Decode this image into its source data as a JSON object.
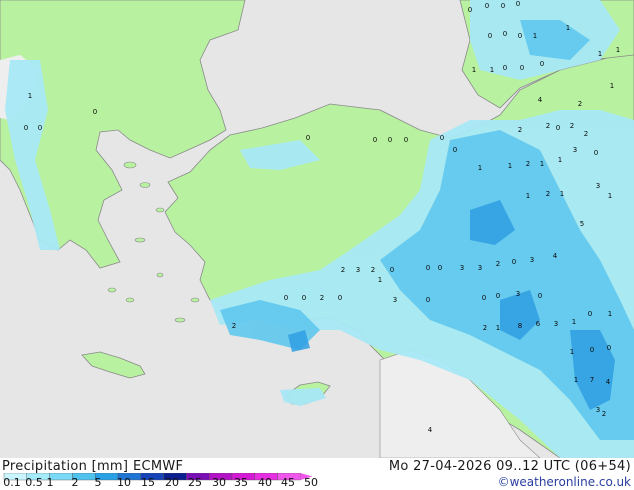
{
  "footer": {
    "product_label": "Precipitation [mm]",
    "model": "ECMWF",
    "valid_time": "Mo 27-04-2026 09..12 UTC (06+54)",
    "credit": "©weatheronline.co.uk"
  },
  "legend": {
    "ticks": [
      "0.1",
      "0.5",
      "1",
      "2",
      "5",
      "10",
      "15",
      "20",
      "25",
      "30",
      "35",
      "40",
      "45",
      "50"
    ],
    "colors": [
      "#c8f5ff",
      "#a6ebfa",
      "#7ad9f4",
      "#4fc3ee",
      "#2aa1e6",
      "#1f74d4",
      "#1644b8",
      "#0b1f8f",
      "#7a0fb5",
      "#b313c7",
      "#d41ad4",
      "#e62fe0",
      "#f055ec"
    ]
  },
  "map_colors": {
    "sea": "#e6e6e6",
    "land_dry": "#eeeeee",
    "land_wet": "#b8f2a0",
    "coast": "#8a8a8a",
    "light_rain": "#a8e8f6",
    "moderate_rain": "#5fc8ee",
    "heavy_rain": "#2f9fe2"
  },
  "precip_labels": [
    "0",
    "0",
    "0",
    "0",
    "0",
    "0",
    "0",
    "1",
    "1",
    "1",
    "1",
    "0",
    "0",
    "0",
    "1",
    "1",
    "1",
    "4",
    "2",
    "0",
    "2",
    "2",
    "2",
    "1",
    "0",
    "0",
    "0",
    "0",
    "0",
    "0",
    "0",
    "0",
    "0",
    "0",
    "1",
    "1",
    "2",
    "1",
    "1",
    "3",
    "2",
    "1",
    "2",
    "1",
    "3",
    "1",
    "5",
    "2",
    "0",
    "0",
    "2",
    "0",
    "3",
    "0",
    "0",
    "0",
    "3",
    "0",
    "1",
    "2",
    "3",
    "2",
    "0",
    "0",
    "0",
    "3",
    "3",
    "2",
    "0",
    "3",
    "4",
    "1",
    "2",
    "8",
    "6",
    "3",
    "1",
    "0",
    "1",
    "1",
    "0",
    "0",
    "4",
    "7",
    "1",
    "3",
    "2",
    "4"
  ]
}
